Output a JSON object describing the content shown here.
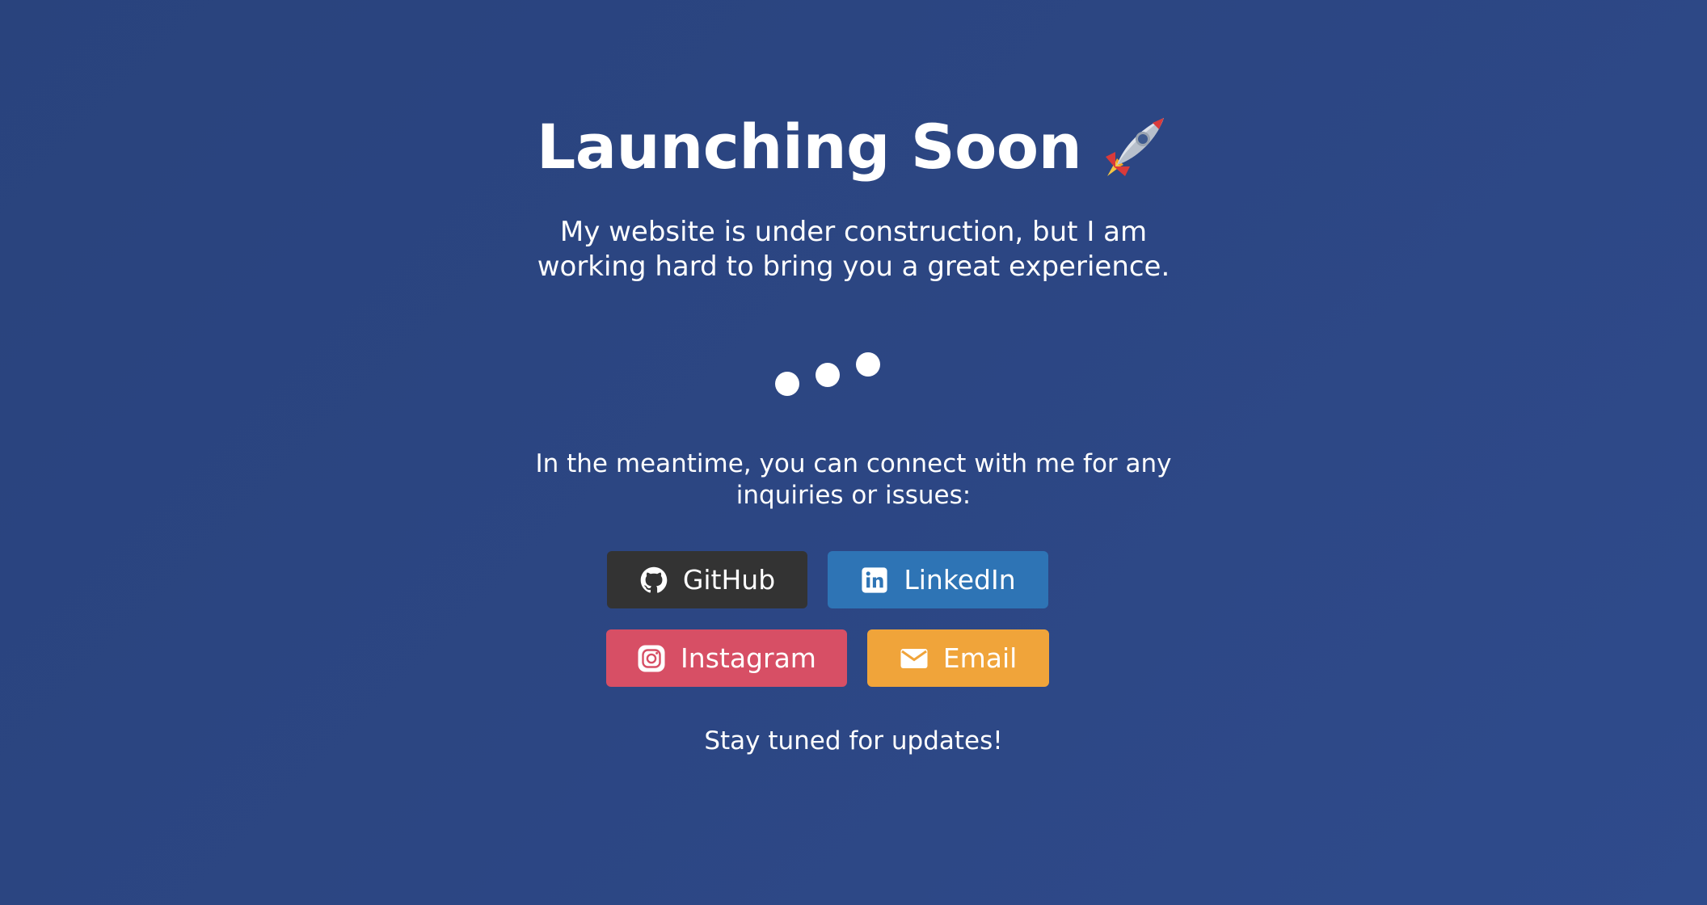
{
  "header": {
    "title": "Launching Soon",
    "title_icon": "rocket-emoji"
  },
  "intro": {
    "text": "My website is under construction, but I am working hard to bring you a great experience."
  },
  "loader": {
    "icon": "three-bouncing-dots",
    "dot_count": 3
  },
  "connect": {
    "text": "In the meantime, you can connect with me for any inquiries or issues:"
  },
  "links": {
    "github": {
      "label": "GitHub",
      "icon": "github-icon",
      "color": "#333333"
    },
    "linkedin": {
      "label": "LinkedIn",
      "icon": "linkedin-icon",
      "color": "#2e74b5"
    },
    "instagram": {
      "label": "Instagram",
      "icon": "instagram-icon",
      "color": "#d74f65"
    },
    "email": {
      "label": "Email",
      "icon": "mail-icon",
      "color": "#f0a43a"
    }
  },
  "footer": {
    "text": "Stay tuned for updates!"
  },
  "colors": {
    "background": "#2c4683",
    "text": "#ffffff"
  }
}
